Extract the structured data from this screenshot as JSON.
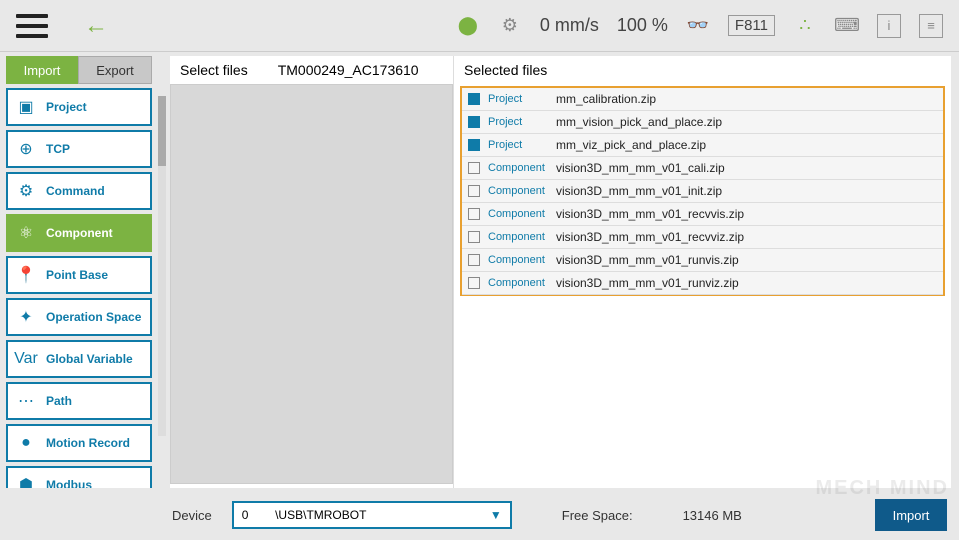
{
  "topbar": {
    "speed": "0 mm/s",
    "percent": "100 %",
    "code": "F811"
  },
  "tabs": {
    "import": "Import",
    "export": "Export"
  },
  "sidebar": {
    "items": [
      {
        "label": "Project"
      },
      {
        "label": "TCP"
      },
      {
        "label": "Command"
      },
      {
        "label": "Component"
      },
      {
        "label": "Point Base"
      },
      {
        "label": "Operation Space"
      },
      {
        "label": "Global Variable"
      },
      {
        "label": "Path"
      },
      {
        "label": "Motion Record"
      },
      {
        "label": "Modbus"
      }
    ]
  },
  "panes": {
    "select_label": "Select files",
    "folder": "TM000249_AC173610",
    "selected_label": "Selected files"
  },
  "files": [
    {
      "type": "Project",
      "name": "mm_calibration.zip",
      "proj": true
    },
    {
      "type": "Project",
      "name": "mm_vision_pick_and_place.zip",
      "proj": true
    },
    {
      "type": "Project",
      "name": "mm_viz_pick_and_place.zip",
      "proj": true
    },
    {
      "type": "Component",
      "name": "vision3D_mm_mm_v01_cali.zip",
      "proj": false
    },
    {
      "type": "Component",
      "name": "vision3D_mm_mm_v01_init.zip",
      "proj": false
    },
    {
      "type": "Component",
      "name": "vision3D_mm_mm_v01_recvvis.zip",
      "proj": false
    },
    {
      "type": "Component",
      "name": "vision3D_mm_mm_v01_recvviz.zip",
      "proj": false
    },
    {
      "type": "Component",
      "name": "vision3D_mm_mm_v01_runvis.zip",
      "proj": false
    },
    {
      "type": "Component",
      "name": "vision3D_mm_mm_v01_runviz.zip",
      "proj": false
    }
  ],
  "footer": {
    "device_label": "Device",
    "device_value": "0        \\USB\\TMROBOT",
    "free_label": "Free Space:",
    "free_value": "13146 MB",
    "import_btn": "Import"
  },
  "watermark": "MECH MIND"
}
